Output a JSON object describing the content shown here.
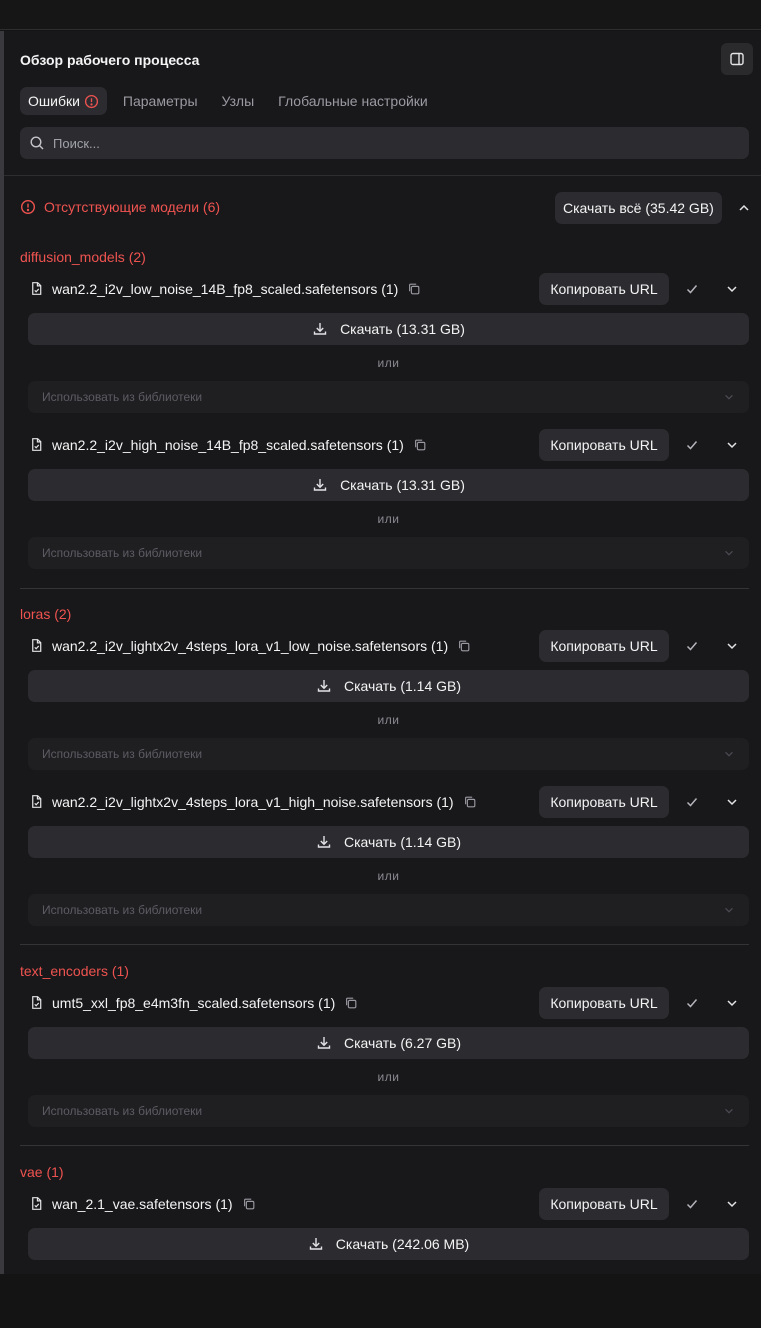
{
  "header": {
    "title": "Обзор рабочего процесса",
    "tabs": [
      {
        "label": "Ошибки"
      },
      {
        "label": "Параметры"
      },
      {
        "label": "Узлы"
      },
      {
        "label": "Глобальные настройки"
      }
    ],
    "search_placeholder": "Поиск..."
  },
  "missing": {
    "title": "Отсутствующие модели (6)",
    "download_all_label": "Скачать всё (35.42 GB)"
  },
  "labels": {
    "copy_url": "Копировать URL",
    "or": "или",
    "use_from_library": "Использовать из библиотеки"
  },
  "groups": [
    {
      "title": "diffusion_models (2)",
      "models": [
        {
          "name": "wan2.2_i2v_low_noise_14B_fp8_scaled.safetensors (1)",
          "download": "Скачать (13.31 GB)"
        },
        {
          "name": "wan2.2_i2v_high_noise_14B_fp8_scaled.safetensors (1)",
          "download": "Скачать (13.31 GB)"
        }
      ]
    },
    {
      "title": "loras (2)",
      "models": [
        {
          "name": "wan2.2_i2v_lightx2v_4steps_lora_v1_low_noise.safetensors (1)",
          "download": "Скачать (1.14 GB)"
        },
        {
          "name": "wan2.2_i2v_lightx2v_4steps_lora_v1_high_noise.safetensors (1)",
          "download": "Скачать (1.14 GB)"
        }
      ]
    },
    {
      "title": "text_encoders (1)",
      "models": [
        {
          "name": "umt5_xxl_fp8_e4m3fn_scaled.safetensors (1)",
          "download": "Скачать (6.27 GB)"
        }
      ]
    },
    {
      "title": "vae (1)",
      "models": [
        {
          "name": "wan_2.1_vae.safetensors (1)",
          "download": "Скачать (242.06 MB)"
        }
      ]
    }
  ],
  "colors": {
    "error": "#ef5350",
    "panel_bg": "#18181a",
    "button_bg": "#2c2c30"
  }
}
